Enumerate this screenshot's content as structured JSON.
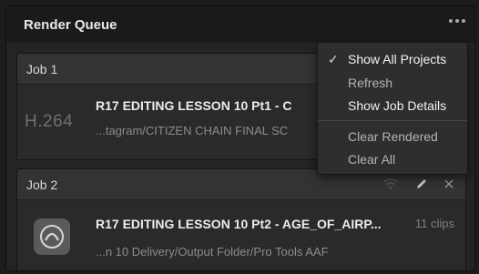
{
  "panel": {
    "title": "Render Queue",
    "options_icon": "more-dots-icon"
  },
  "jobs": [
    {
      "label": "Job 1",
      "codec": "H.264",
      "title": "R17 EDITING LESSON 10 Pt1 - C",
      "path": "...tagram/CITIZEN CHAIN FINAL SC",
      "clips": ""
    },
    {
      "label": "Job 2",
      "codec_icon": "pro-tools-icon",
      "title": "R17 EDITING LESSON 10 Pt2 - AGE_OF_AIRP...",
      "path": "...n 10 Delivery/Output Folder/Pro Tools AAF",
      "clips": "11 clips",
      "actions": [
        "wifi-icon",
        "edit-pencil-icon",
        "close-icon"
      ]
    }
  ],
  "menu": {
    "items": [
      {
        "label": "Show All Projects",
        "checked": true
      },
      {
        "label": "Refresh",
        "checked": false
      },
      {
        "label": "Show Job Details",
        "checked": false
      },
      {
        "label": "Clear Rendered",
        "checked": false
      },
      {
        "label": "Clear All",
        "checked": false
      }
    ]
  },
  "colors": {
    "panel_bg": "#242424",
    "header_bg": "#1a1a1a",
    "menu_bg": "#2e2e2e",
    "text_primary": "#ececec",
    "text_secondary": "#8c8c8c"
  }
}
